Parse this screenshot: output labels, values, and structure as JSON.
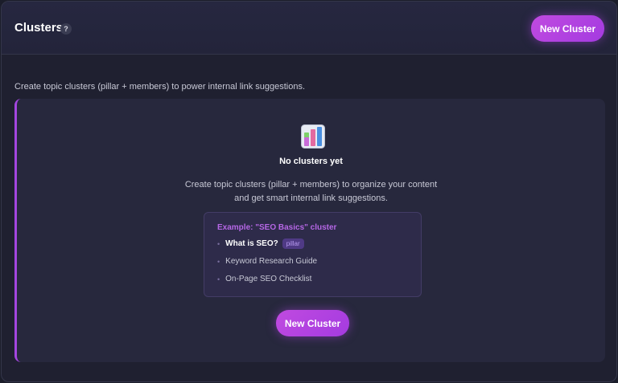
{
  "header": {
    "title": "Clusters",
    "help_label": "?",
    "new_button_label": "New Cluster"
  },
  "description": "Create topic clusters (pillar + members) to power internal link suggestions.",
  "empty_state": {
    "icon": "bar-chart-icon",
    "title": "No clusters yet",
    "text_line1": "Create topic clusters (pillar + members) to organize your content",
    "text_line2": "and get smart internal link suggestions.",
    "example": {
      "title": "Example: \"SEO Basics\" cluster",
      "items": [
        {
          "label": "What is SEO?",
          "badge": "pillar"
        },
        {
          "label": "Keyword Research Guide"
        },
        {
          "label": "On-Page SEO Checklist"
        }
      ]
    },
    "button_label": "New Cluster"
  },
  "colors": {
    "accent": "#a446e0",
    "background": "#1f2030",
    "card": "#27283d"
  }
}
